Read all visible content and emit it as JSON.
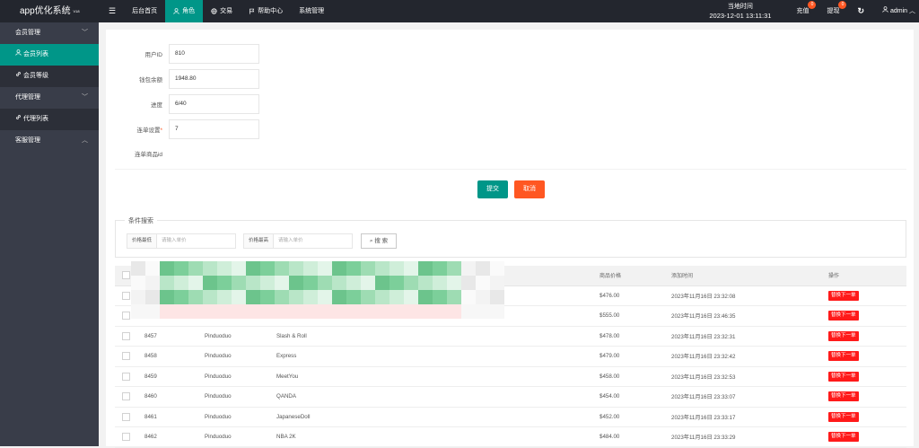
{
  "brand": {
    "name": "app优化系统",
    "version": "V18"
  },
  "nav": [
    {
      "label": "后台首页",
      "icon": ""
    },
    {
      "label": "角色",
      "icon": "user-icon",
      "active": true
    },
    {
      "label": "交易",
      "icon": "globe-icon"
    },
    {
      "label": "帮助中心",
      "icon": "flag-icon"
    },
    {
      "label": "系统管理",
      "icon": ""
    }
  ],
  "topright": {
    "clock_label": "当地时间",
    "clock_value": "2023-12-01 13:11:31",
    "recharge": {
      "label": "充值",
      "badge": "0"
    },
    "withdraw": {
      "label": "提现",
      "badge": "0"
    },
    "user": "admin"
  },
  "sidebar": {
    "groups": [
      {
        "label": "会员管理",
        "items": [
          {
            "label": "会员列表",
            "icon": "user-icon",
            "active": true
          },
          {
            "label": "会员等级",
            "icon": "link-icon"
          }
        ]
      },
      {
        "label": "代理管理",
        "items": [
          {
            "label": "代理列表",
            "icon": "link-icon"
          }
        ]
      },
      {
        "label": "客服管理",
        "items": []
      }
    ]
  },
  "form": {
    "user_id": {
      "label": "用户ID",
      "value": "810"
    },
    "balance": {
      "label": "钱包余额",
      "value": "1948.80"
    },
    "progress": {
      "label": "进度",
      "value": "6/40"
    },
    "chain": {
      "label": "连单设置",
      "value": "7"
    },
    "chain_goods": {
      "label": "连单商品id"
    },
    "submit": "提交",
    "cancel": "取消"
  },
  "search": {
    "legend": "条件搜索",
    "min_label": "价格最低",
    "min_placeholder": "请输入单价",
    "max_label": "价格最高",
    "max_placeholder": "请输入单价",
    "button": "搜 索"
  },
  "table": {
    "headers": {
      "price": "商品价格",
      "time": "添加时间",
      "op": "操作"
    },
    "rows": [
      {
        "id": "",
        "platform": "",
        "name": "",
        "price": "$476.00",
        "time": "2023年11月16日 23:32:08",
        "op": "替换下一单"
      },
      {
        "id": "",
        "platform": "",
        "name": "",
        "price": "$555.00",
        "time": "2023年11月16日 23:46:35",
        "op": "替换下一单"
      },
      {
        "id": "8457",
        "platform": "Pinduoduo",
        "name": "Slash & Roll",
        "price": "$478.00",
        "time": "2023年11月16日 23:32:31",
        "op": "替换下一单"
      },
      {
        "id": "8458",
        "platform": "Pinduoduo",
        "name": "Express",
        "price": "$479.00",
        "time": "2023年11月16日 23:32:42",
        "op": "替换下一单"
      },
      {
        "id": "8459",
        "platform": "Pinduoduo",
        "name": "MeetYou",
        "price": "$458.00",
        "time": "2023年11月16日 23:32:53",
        "op": "替换下一单"
      },
      {
        "id": "8460",
        "platform": "Pinduoduo",
        "name": "QANDA",
        "price": "$454.00",
        "time": "2023年11月16日 23:33:07",
        "op": "替换下一单"
      },
      {
        "id": "8461",
        "platform": "Pinduoduo",
        "name": "JapaneseDoll",
        "price": "$452.00",
        "time": "2023年11月16日 23:33:17",
        "op": "替换下一单"
      },
      {
        "id": "8462",
        "platform": "Pinduoduo",
        "name": "NBA 2K",
        "price": "$484.00",
        "time": "2023年11月16日 23:33:29",
        "op": "替换下一单"
      }
    ]
  }
}
